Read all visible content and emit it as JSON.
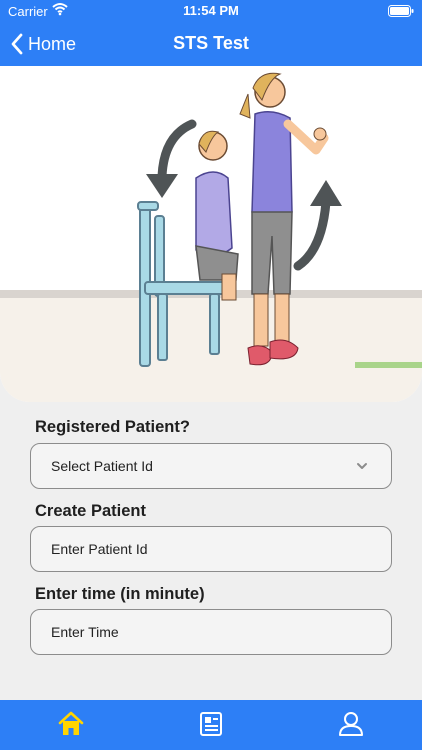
{
  "status_bar": {
    "carrier": "Carrier",
    "time": "11:54 PM"
  },
  "nav": {
    "back_label": "Home",
    "title": "STS Test"
  },
  "form": {
    "registered_label": "Registered Patient?",
    "select_placeholder": "Select Patient Id",
    "create_label": "Create Patient",
    "patient_id_placeholder": "Enter Patient Id",
    "time_label": "Enter time (in minute)",
    "time_placeholder": "Enter Time"
  },
  "tabs": [
    {
      "icon": "home-icon",
      "active": true
    },
    {
      "icon": "document-icon",
      "active": false
    },
    {
      "icon": "user-icon",
      "active": false
    }
  ],
  "colors": {
    "primary": "#2d7ff6",
    "active_tab_icon": "#ffd400",
    "tab_icon": "#ffffff"
  }
}
